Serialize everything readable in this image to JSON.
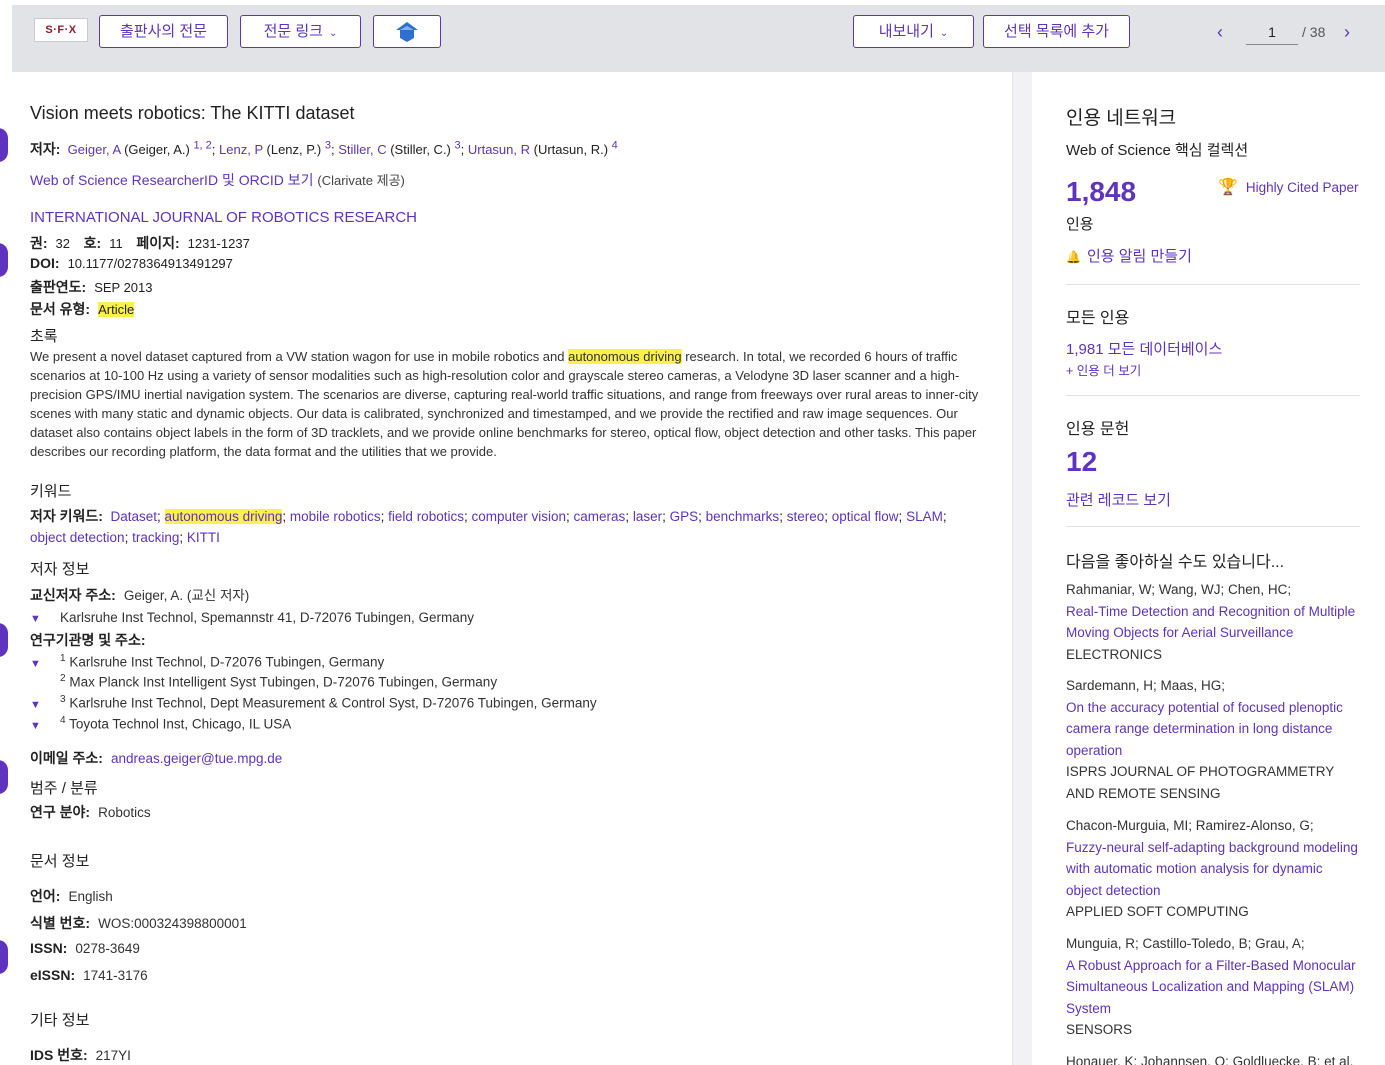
{
  "toolbar": {
    "logo": "S·F·X",
    "publisher_fulltext": "출판사의 전문",
    "fulltext_links": "전문 링크",
    "export": "내보내기",
    "add_to_list": "선택 목록에 추가",
    "page_current": "1",
    "page_total": "/ 38",
    "prev": "‹",
    "next": "›"
  },
  "record": {
    "title": "Vision meets robotics: The KITTI dataset",
    "authors_label": "저자:",
    "authors": [
      {
        "link": "Geiger, A",
        "full": "(Geiger, A.)",
        "sup": "1, 2"
      },
      {
        "link": "Lenz, P",
        "full": "(Lenz, P.)",
        "sup": "3"
      },
      {
        "link": "Stiller, C",
        "full": "(Stiller, C.)",
        "sup": "3"
      },
      {
        "link": "Urtasun, R",
        "full": "(Urtasun, R.)",
        "sup": "4"
      }
    ],
    "rid_link": "Web of Science ResearcherID 및 ORCID 보기",
    "rid_suffix": "(Clarivate 제공)",
    "journal": "INTERNATIONAL JOURNAL OF ROBOTICS RESEARCH",
    "volume_label": "권:",
    "volume": "32",
    "issue_label": "호:",
    "issue": "11",
    "pages_label": "페이지:",
    "pages": "1231-1237",
    "doi_label": "DOI:",
    "doi": "10.1177/0278364913491297",
    "pubdate_label": "출판연도:",
    "pubdate": "SEP 2013",
    "doctype_label": "문서 유형:",
    "doctype": "Article",
    "abstract_heading": "초록",
    "abstract_pre": "We present a novel dataset captured from a VW station wagon for use in mobile robotics and ",
    "abstract_hl": "autonomous driving",
    "abstract_post": " research. In total, we recorded 6 hours of traffic scenarios at 10-100 Hz using a variety of sensor modalities such as high-resolution color and grayscale stereo cameras, a Velodyne 3D laser scanner and a high-precision GPS/IMU inertial navigation system. The scenarios are diverse, capturing real-world traffic situations, and range from freeways over rural areas to inner-city scenes with many static and dynamic objects. Our data is calibrated, synchronized and timestamped, and we provide the rectified and raw image sequences. Our dataset also contains object labels in the form of 3D tracklets, and we provide online benchmarks for stereo, optical flow, object detection and other tasks. This paper describes our recording platform, the data format and the utilities that we provide.",
    "keywords_heading": "키워드",
    "author_keywords_label": "저자 키워드:",
    "keywords": [
      "Dataset",
      "autonomous driving",
      "mobile robotics",
      "field robotics",
      "computer vision",
      "cameras",
      "laser",
      "GPS",
      "benchmarks",
      "stereo",
      "optical flow",
      "SLAM",
      "object detection",
      "tracking",
      "KITTI"
    ],
    "author_info_heading": "저자 정보",
    "corresponding_label": "교신저자 주소:",
    "corresponding": "Geiger, A. (교신 저자)",
    "corresponding_addr": "Karlsruhe Inst Technol, Spemannstr 41, D-72076 Tubingen, Germany",
    "affil_label": "연구기관명 및 주소:",
    "affiliations": [
      {
        "n": "1",
        "text": "Karlsruhe Inst Technol, D-72076 Tubingen, Germany"
      },
      {
        "n": "2",
        "text": "Max Planck Inst Intelligent Syst Tubingen, D-72076 Tubingen, Germany"
      },
      {
        "n": "3",
        "text": "Karlsruhe Inst Technol, Dept Measurement & Control Syst, D-72076 Tubingen, Germany"
      },
      {
        "n": "4",
        "text": "Toyota Technol Inst, Chicago, IL USA"
      }
    ],
    "email_label": "이메일 주소:",
    "email": "andreas.geiger@tue.mpg.de",
    "category_heading": "범주 / 분류",
    "research_area_label": "연구 분야:",
    "research_area": "Robotics",
    "doc_info_heading": "문서 정보",
    "language_label": "언어:",
    "language": "English",
    "accession_label": "식별 번호:",
    "accession": "WOS:000324398800001",
    "issn_label": "ISSN:",
    "issn": "0278-3649",
    "eissn_label": "eISSN:",
    "eissn": "1741-3176",
    "other_heading": "기타 정보",
    "ids_label": "IDS 번호:",
    "ids": "217YI"
  },
  "sidebar": {
    "citation_network": "인용 네트워크",
    "core_collection": "Web of Science 핵심 컬렉션",
    "citations": "1,848",
    "citations_label": "인용",
    "highly_cited": "Highly Cited Paper",
    "alert": "인용 알림 만들기",
    "all_citations": "모든 인용",
    "all_db": "1,981 모든 데이터베이스",
    "more": "+ 인용 더 보기",
    "cited_refs": "인용 문헌",
    "cited_refs_count": "12",
    "related": "관련 레코드 보기",
    "you_may_like": "다음을 좋아하실 수도 있습니다...",
    "recommendations": [
      {
        "authors": "Rahmaniar, W; Wang, WJ; Chen, HC;",
        "title": "Real-Time Detection and Recognition of Multiple Moving Objects for Aerial Surveillance",
        "journal": "ELECTRONICS"
      },
      {
        "authors": "Sardemann, H; Maas, HG;",
        "title": "On the accuracy potential of focused plenoptic camera range determination in long distance operation",
        "journal": "ISPRS JOURNAL OF PHOTOGRAMMETRY AND REMOTE SENSING"
      },
      {
        "authors": "Chacon-Murguia, MI; Ramirez-Alonso, G;",
        "title": "Fuzzy-neural self-adapting background modeling with automatic motion analysis for dynamic object detection",
        "journal": "APPLIED SOFT COMPUTING"
      },
      {
        "authors": "Munguia, R; Castillo-Toledo, B; Grau, A;",
        "title": "A Robust Approach for a Filter-Based Monocular Simultaneous Localization and Mapping (SLAM) System",
        "journal": "SENSORS"
      },
      {
        "authors": "Honauer, K; Johannsen, O; Goldluecke, B; et al.",
        "title": "",
        "journal": ""
      }
    ]
  },
  "colors": {
    "accent": "#5e33bf",
    "highlight": "#fbf14a",
    "toolbar_bg": "#e2e3e6",
    "trophy": "#d9362f"
  }
}
